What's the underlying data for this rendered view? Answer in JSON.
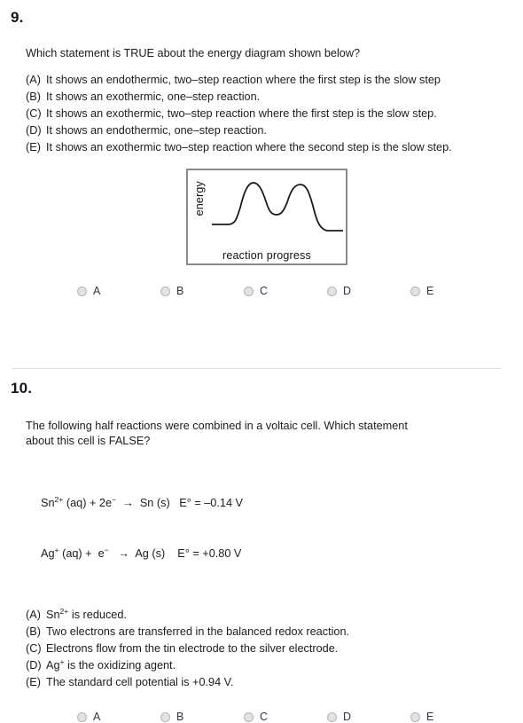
{
  "page": {
    "background": "#ffffff",
    "text_color": "#1c1c1c",
    "label_color": "#2c3550"
  },
  "questions": [
    {
      "number": "9.",
      "prompt": "Which statement is TRUE about the energy diagram shown below?",
      "choices": [
        {
          "letter": "(A)",
          "text": "It shows an endothermic, two–step reaction where the first step is the slow step"
        },
        {
          "letter": "(B)",
          "text": "It shows an exothermic, one–step reaction."
        },
        {
          "letter": "(C)",
          "text": "It shows an exothermic, two–step reaction where the first step is the slow step."
        },
        {
          "letter": "(D)",
          "text": "It shows an endothermic, one–step reaction."
        },
        {
          "letter": "(E)",
          "text": "It shows an exothermic two–step reaction where the second step is the slow step."
        }
      ],
      "diagram": {
        "y_axis_label": "energy",
        "x_axis_label": "reaction progress"
      },
      "answers": [
        {
          "value": "A",
          "selected": false
        },
        {
          "value": "B",
          "selected": false
        },
        {
          "value": "C",
          "selected": false
        },
        {
          "value": "D",
          "selected": false
        },
        {
          "value": "E",
          "selected": false
        }
      ]
    },
    {
      "number": "10.",
      "prompt_line1": "The following half reactions were combined in a voltaic cell.  Which statement",
      "prompt_line2": "about this cell is FALSE?",
      "equations": [
        {
          "reactant": "Sn",
          "reactant_charge": "2+",
          "reactant_state": " (aq) + 2e",
          "electron_charge": "−",
          "arrow": "  →  Sn (s)",
          "potential": "E° = –0.14 V"
        },
        {
          "reactant": "Ag",
          "reactant_charge": "+",
          "reactant_state": " (aq) +  e",
          "electron_charge": "−",
          "arrow": "   →  Ag (s)",
          "potential": "E° = +0.80 V"
        }
      ],
      "choices": [
        {
          "letter": "(A)",
          "text_pre": "Sn",
          "sup": "2+",
          "text_post": " is reduced."
        },
        {
          "letter": "(B)",
          "text_pre": "Two electrons are transferred in the balanced redox reaction.",
          "sup": "",
          "text_post": ""
        },
        {
          "letter": "(C)",
          "text_pre": "Electrons flow from the tin electrode to the silver electrode.",
          "sup": "",
          "text_post": ""
        },
        {
          "letter": "(D)",
          "text_pre": "Ag",
          "sup": "+",
          "text_post": " is the oxidizing agent."
        },
        {
          "letter": "(E)",
          "text_pre": "The standard cell potential is +0.94 V.",
          "sup": "",
          "text_post": ""
        }
      ],
      "answers": [
        {
          "value": "A",
          "selected": false
        },
        {
          "value": "B",
          "selected": false
        },
        {
          "value": "C",
          "selected": false
        },
        {
          "value": "D",
          "selected": false
        },
        {
          "value": "E",
          "selected": false
        }
      ]
    }
  ]
}
